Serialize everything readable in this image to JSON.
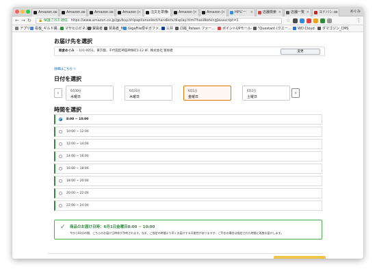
{
  "browser": {
    "tabs": [
      {
        "label": "Amazon.co",
        "favicon_color": "#222222"
      },
      {
        "label": "Amazon.co",
        "favicon_color": "#222222"
      },
      {
        "label": "Amazon.co",
        "favicon_color": "#222222"
      },
      {
        "label": "Amazon |",
        "favicon_color": "#222222"
      },
      {
        "label": "注文を準備",
        "favicon_color": "#222222"
      },
      {
        "label": "Amazon |",
        "favicon_color": "#222222"
      },
      {
        "label": "Amazon |",
        "favicon_color": "#222222"
      },
      {
        "label": "HPピー",
        "favicon_color": "#3b8ad8"
      },
      {
        "label": "店舗検索",
        "favicon_color": "#e04040"
      },
      {
        "label": "店舗一覧",
        "favicon_color": "#555555"
      },
      {
        "label": "ヨドバシ.co",
        "favicon_color": "#d02020"
      }
    ],
    "active_tab_index": 4,
    "user": "めぐみ",
    "security_label": "保護された通信",
    "url": "https://www.amazon.co.jp/gp/buy/shipoptionselect/handlers/display.html?hasWorkingJavascript=1",
    "bookmarks": [
      {
        "label": "アプリ",
        "color": "#7a7a7a"
      },
      {
        "label": "看板_ギルド構…",
        "color": "#4a7fd4"
      },
      {
        "label": "マサヒロビネスメン…",
        "color": "#2e8b3c"
      },
      {
        "label": "貿易者",
        "color": "#555555"
      },
      {
        "label": "貿易者_HP",
        "color": "#555555"
      },
      {
        "label": "GigaFile便ギガファ…",
        "color": "#3b8ad8"
      },
      {
        "label": "三井",
        "color": "#0a3d8f"
      },
      {
        "label": "凸版_Pateen ファー…",
        "color": "#555555"
      },
      {
        "label": "ポイントUPモール-",
        "color": "#e04040"
      },
      {
        "label": "\"Questant (クエー…",
        "color": "#555555"
      },
      {
        "label": "WD Cloud",
        "color": "#2a6fd0"
      },
      {
        "label": "ダマゴジン_CMS",
        "color": "#555555"
      }
    ]
  },
  "page": {
    "address_heading": "お届け先を選択",
    "address_name": "飯倉めぐみ",
    "address_text": "- 101-0051，東京都，千代田区神田神保町1-12 8F, 株式会社 貿易者",
    "change_button": "変更",
    "details_link": "詳細はこちら ▽",
    "date_heading": "日付を選択",
    "dates": [
      {
        "date": "6月30日",
        "day": "木曜日"
      },
      {
        "date": "6月31日",
        "day": "木曜日"
      },
      {
        "date": "6月1日",
        "day": "金曜日"
      },
      {
        "date": "6月2日",
        "day": "土曜日"
      }
    ],
    "selected_date_index": 2,
    "time_heading": "時間を選択",
    "times": [
      "8:00 ~ 10:00",
      "10:00 ~ 12:00",
      "12:00 ~ 14:00",
      "14:00 ~ 16:00",
      "16:00 ~ 18:00",
      "18:00 ~ 20:00",
      "20:00 ~ 22:00",
      "22:00 ~ 24:00"
    ],
    "selected_time_index": 0,
    "confirmation_title": "商品のお届け日時：6月1日金曜日8:00 ~ 10:00",
    "confirmation_desc": "今から60分の間、こちらのお届け日時枠が予約されます。なお、ご指定の時間より早くお届けする可能性がありますが、ご不在の場合は指定された時間に再度お届けします。"
  },
  "colors": {
    "selected_accent": "#e77600",
    "green_accent": "#2f8a3c",
    "link_blue": "#0066c0"
  }
}
